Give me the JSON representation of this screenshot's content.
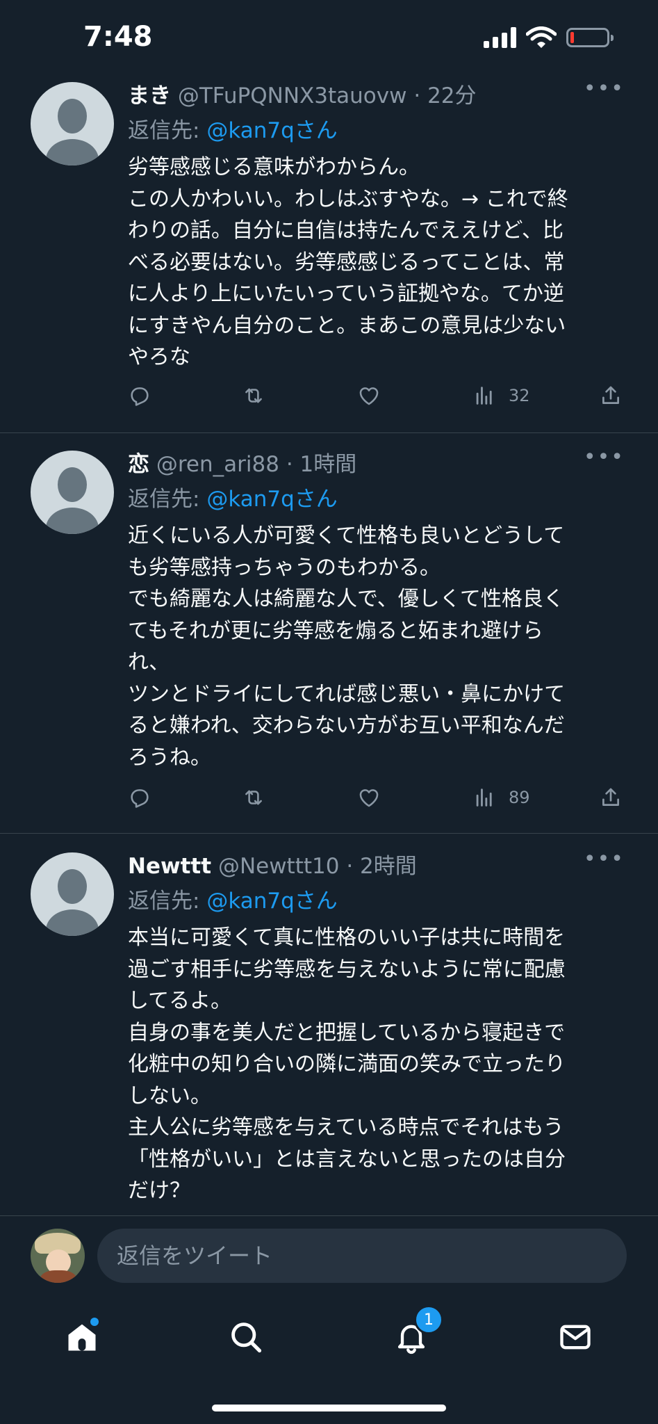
{
  "status_bar": {
    "time": "7:48",
    "battery_level": 0.1
  },
  "colors": {
    "background": "#15202b",
    "accent": "#1d9bf0",
    "muted": "#8b98a5",
    "divider": "#38444d"
  },
  "tweets": [
    {
      "name": "まき",
      "handle": "@TFuPQNNX3tauovw",
      "separator": "·",
      "time": "22分",
      "reply_prefix": "返信先: ",
      "reply_to": "@kan7qさん",
      "text": "劣等感感じる意味がわからん。\nこの人かわいい。わしはぶすやな。→ これで終\nわりの話。自分に自信は持たんでええけど、比\nべる必要はない。劣等感感じるってことは、常\nに人より上にいたいっていう証拠やな。てか逆\nにすきやん自分のこと。まあこの意見は少ない\nやろな",
      "views": "32"
    },
    {
      "name": "恋",
      "handle": "@ren_ari88",
      "separator": "·",
      "time": "1時間",
      "reply_prefix": "返信先: ",
      "reply_to": "@kan7qさん",
      "text": "近くにいる人が可愛くて性格も良いとどうして\nも劣等感持っちゃうのもわかる。\nでも綺麗な人は綺麗な人で、優しくて性格良く\nてもそれが更に劣等感を煽ると妬まれ避けら\nれ、\nツンとドライにしてれば感じ悪い・鼻にかけて\nると嫌われ、交わらない方がお互い平和なんだ\nろうね。",
      "views": "89"
    },
    {
      "name": "Newttt",
      "handle": "@Newttt10",
      "separator": "·",
      "time": "2時間",
      "reply_prefix": "返信先: ",
      "reply_to": "@kan7qさん",
      "text": "本当に可愛くて真に性格のいい子は共に時間を\n過ごす相手に劣等感を与えないように常に配慮\nしてるよ。\n自身の事を美人だと把握しているから寝起きで\n化粧中の知り合いの隣に満面の笑みで立ったり\nしない。\n主人公に劣等感を与えている時点でそれはもう\n「性格がいい」とは言えないと思ったのは自分\nだけ？",
      "views": ""
    }
  ],
  "reply_bar": {
    "placeholder": "返信をツイート"
  },
  "tab_bar": {
    "notifications_badge": "1"
  }
}
